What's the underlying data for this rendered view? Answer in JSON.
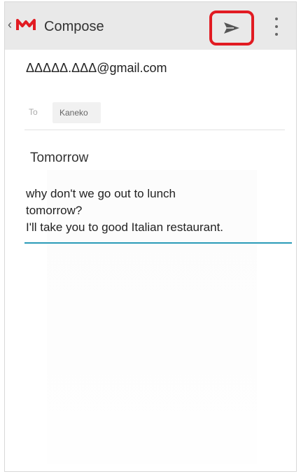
{
  "appbar": {
    "title": "Compose",
    "back_glyph": "‹",
    "logo_icon": "mail-logo-icon",
    "send_icon": "send-icon",
    "more_icon": "more-vert-icon",
    "send_highlight_color": "#e11b22"
  },
  "compose": {
    "from": "ΔΔΔΔΔ.ΔΔΔ@gmail.com",
    "to_label": "To",
    "to_recipient": "Kaneko",
    "subject": "Tomorrow",
    "body_lines": [
      "why don't we go out to lunch",
      "tomorrow?",
      "I'll take you to good Italian restaurant."
    ]
  }
}
